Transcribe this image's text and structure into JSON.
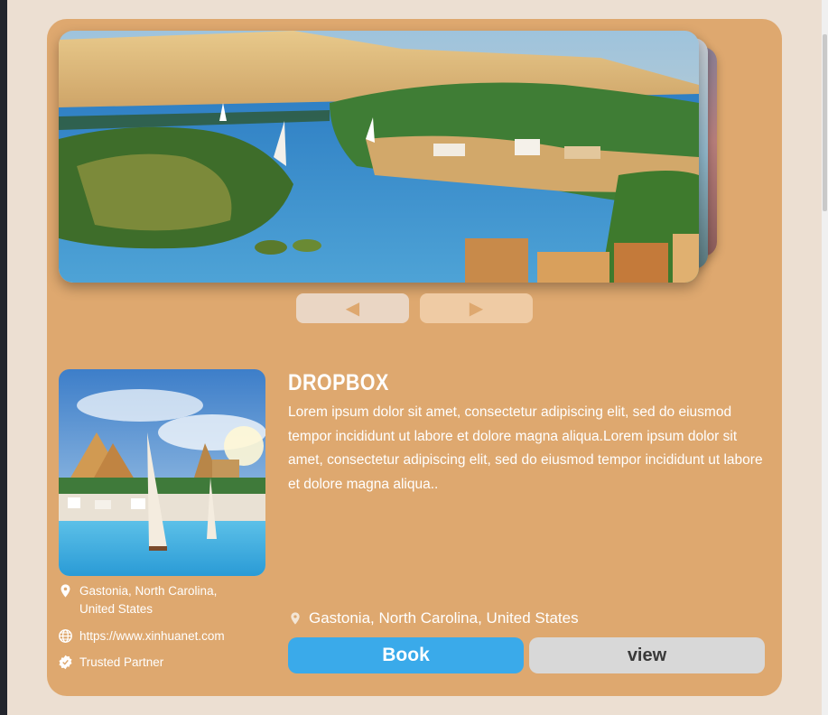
{
  "carousel": {
    "main_image": "nile-river-aswan-photo",
    "prev_icon": "◀",
    "next_icon": "▶"
  },
  "listing": {
    "thumbnail": "pyramids-nile-feluccas-photo",
    "title": "DROPBOX",
    "description": "Lorem ipsum dolor sit amet, consectetur adipiscing elit, sed do eiusmod tempor incididunt ut labore et dolore magna aliqua.Lorem ipsum dolor sit amet, consectetur adipiscing elit, sed do eiusmod tempor incididunt ut labore et dolore magna aliqua..",
    "location_line1": "Gastonia, North Carolina,",
    "location_line2": "United States",
    "website": "https://www.xinhuanet.com",
    "badge": "Trusted Partner",
    "location_full": "Gastonia, North Carolina, United States"
  },
  "actions": {
    "book_label": "Book",
    "view_label": "view"
  },
  "colors": {
    "page_bg": "#ecdfd2",
    "card_bg": "#dea86f",
    "book_button": "#3aaaea",
    "view_button": "#d8d8d8"
  }
}
